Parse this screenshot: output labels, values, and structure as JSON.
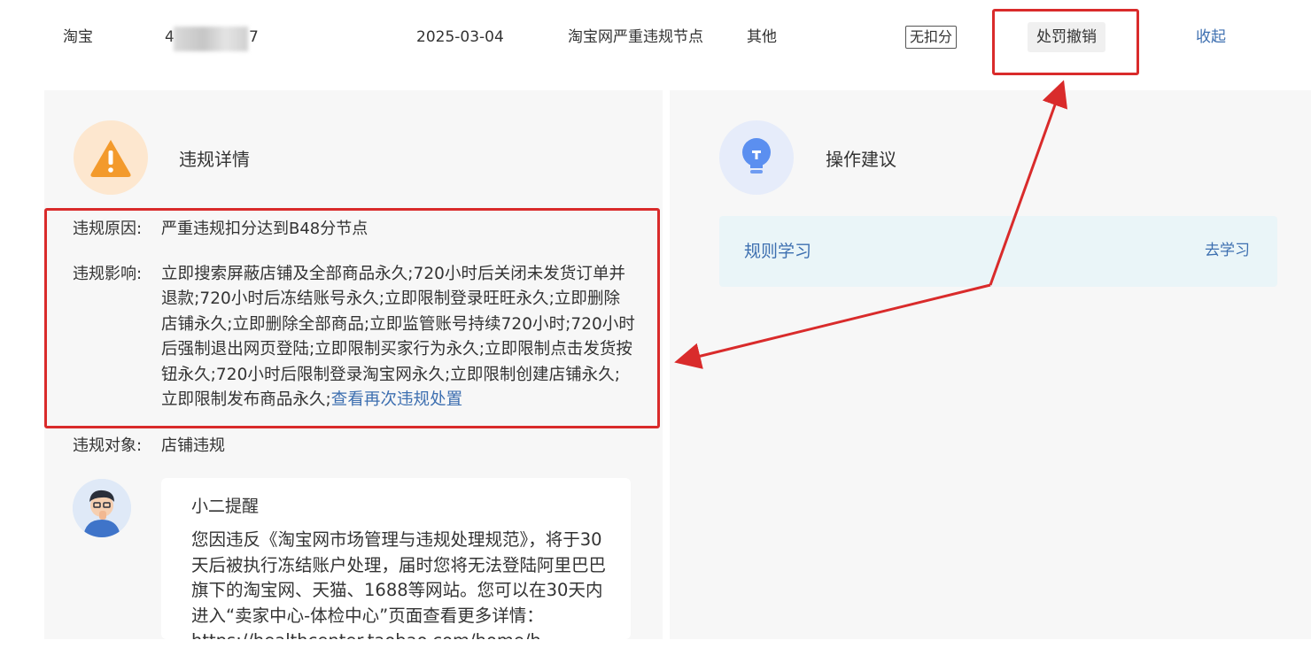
{
  "record": {
    "platform": "淘宝",
    "id_prefix": "4",
    "id_suffix": "7",
    "date": "2025-03-04",
    "node": "淘宝网严重违规节点",
    "type": "其他",
    "deduction_badge": "无扣分",
    "revoke_button": "处罚撤销",
    "collapse_link": "收起"
  },
  "details": {
    "icon": "warning-icon",
    "title": "违规详情",
    "reason_label": "违规原因:",
    "reason_value": "严重违规扣分达到B48分节点",
    "impact_label": "违规影响:",
    "impact_text": "立即搜索屏蔽店铺及全部商品永久;720小时后关闭未发货订单并退款;720小时后冻结账号永久;立即限制登录旺旺永久;立即删除店铺永久;立即删除全部商品;立即监管账号持续720小时;720小时后强制退出网页登陆;立即限制买家行为永久;立即限制点击发货按钮永久;720小时后限制登录淘宝网永久;立即限制创建店铺永久;立即限制发布商品永久;",
    "impact_link": "查看再次违规处置",
    "target_label": "违规对象:",
    "target_value": "店铺违规"
  },
  "advice": {
    "icon": "lightbulb-icon",
    "title": "操作建议",
    "rule_label": "规则学习",
    "rule_link": "去学习"
  },
  "reminder": {
    "avatar": "staff-avatar",
    "title": "小二提醒",
    "body": "您因违反《淘宝网市场管理与违规处理规范》，将于30天后被执行冻结账户处理，届时您将无法登陆阿里巴巴旗下的淘宝网、天猫、1688等网站。您可以在30天内进入“卖家中心-体检中心”页面查看更多详情：https://healthcenter.taobao.com/home/h"
  },
  "colors": {
    "annotation_red": "#d92b2b",
    "link_blue": "#3d6fb0",
    "panel_bg": "#f7f7f7",
    "warning_orange": "#f39a2c"
  }
}
